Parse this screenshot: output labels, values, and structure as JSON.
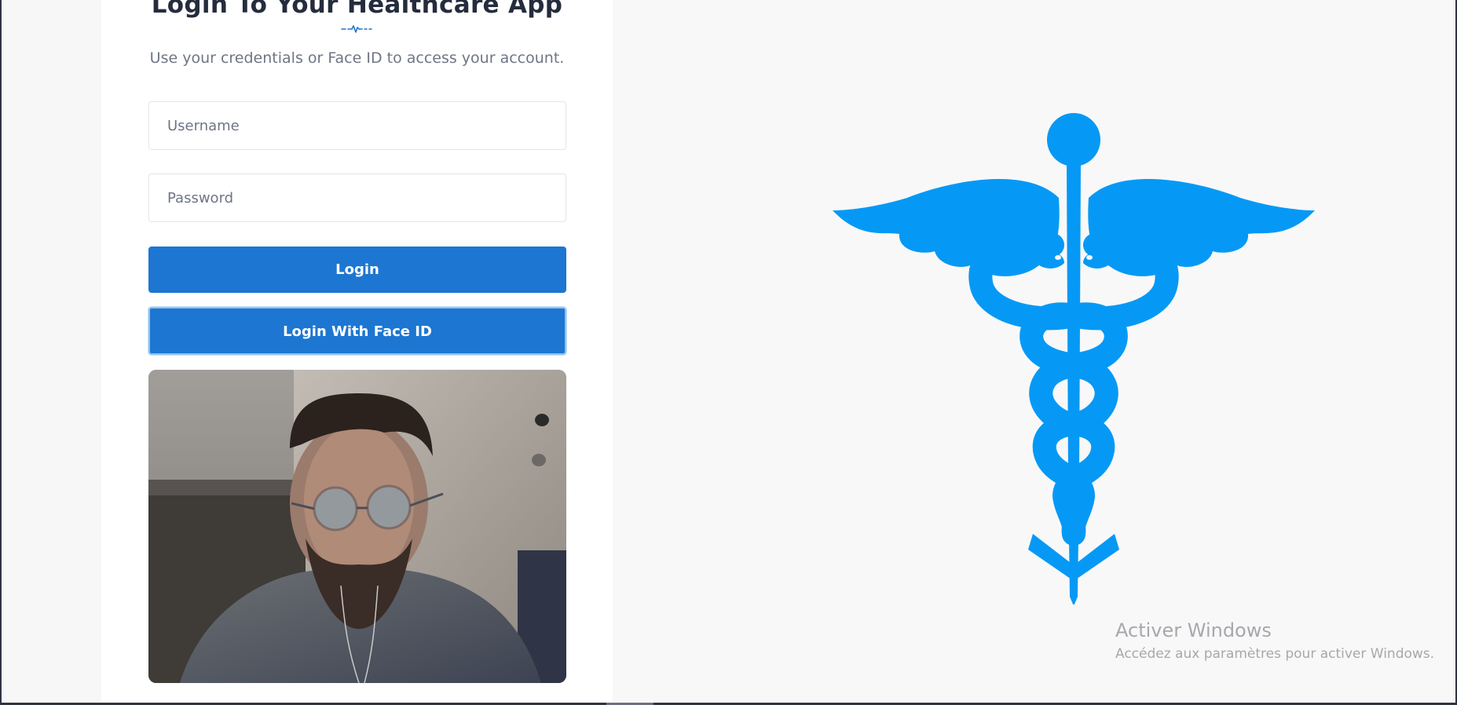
{
  "header": {
    "title": "Login To Your Healthcare App",
    "subtitle": "Use your credentials or Face ID to access your account."
  },
  "form": {
    "username_placeholder": "Username",
    "password_placeholder": "Password",
    "login_label": "Login",
    "face_id_label": "Login With Face ID"
  },
  "icons": {
    "divider": "heartbeat-pulse-icon",
    "hero": "caduceus-icon",
    "camera": "webcam-feed"
  },
  "colors": {
    "primary": "#1d76d2",
    "caduceus": "#0599f5",
    "text_dark": "#252c3d",
    "text_muted": "#6f7585",
    "watermark": "#a6a8ac"
  },
  "watermark": {
    "title": "Activer Windows",
    "subtitle": "Accédez aux paramètres pour activer Windows."
  }
}
